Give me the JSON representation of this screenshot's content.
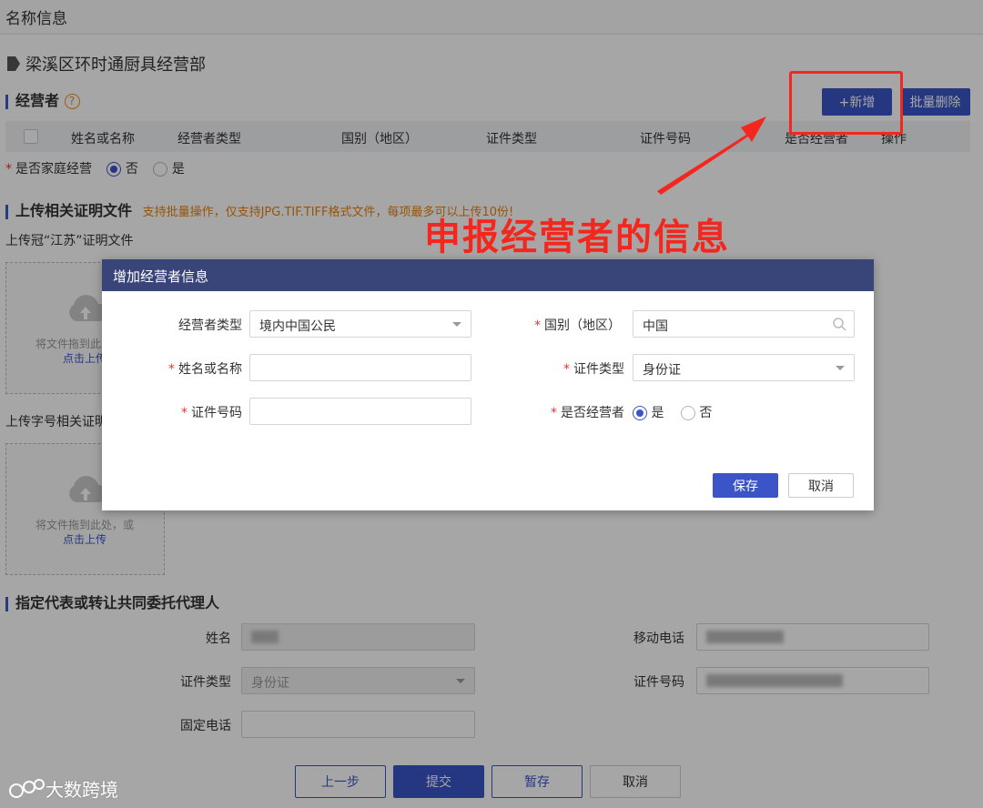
{
  "header": {
    "title": "名称信息"
  },
  "entity": {
    "name": "梁溪区环时通厨具经营部"
  },
  "operators": {
    "title": "经营者",
    "add_label": "+新增",
    "batch_delete_label": "批量删除",
    "columns": [
      "姓名或名称",
      "经营者类型",
      "国别（地区）",
      "证件类型",
      "证件号码",
      "是否经营者",
      "操作"
    ],
    "family_label": "是否家庭经营",
    "family_no": "否",
    "family_yes": "是"
  },
  "upload": {
    "title": "上传相关证明文件",
    "hint": "支持批量操作，仅支持JPG.TIF.TIFF格式文件，每项最多可以上传10份!",
    "guan_label": "上传冠“江苏”证明文件",
    "zihao_label": "上传字号相关证明",
    "drop_text": "将文件拖到此处，或",
    "drop_text_clipped": "将文件拖到此处",
    "click_upload": "点击上传",
    "click_upload_clipped": "点击上传"
  },
  "annotation": {
    "text": "申报经营者的信息",
    "color": "#f3271e"
  },
  "dialog": {
    "title": "增加经营者信息",
    "type_label": "经营者类型",
    "type_value": "境内中国公民",
    "country_label": "国别（地区）",
    "country_value": "中国",
    "name_label": "姓名或名称",
    "name_value": "",
    "idtype_label": "证件类型",
    "idtype_value": "身份证",
    "idno_label": "证件号码",
    "idno_value": "",
    "is_operator_label": "是否经营者",
    "yes": "是",
    "no": "否",
    "save": "保存",
    "cancel": "取消"
  },
  "agent": {
    "title": "指定代表或转让共同委托代理人",
    "name_label": "姓名",
    "mobile_label": "移动电话",
    "idtype_label": "证件类型",
    "idtype_value": "身份证",
    "idno_label": "证件号码",
    "phone_label": "固定电话"
  },
  "footer": {
    "prev": "上一步",
    "submit": "提交",
    "draft": "暂存",
    "cancel": "取消"
  },
  "watermark": {
    "text": "大数跨境"
  },
  "colors": {
    "primary": "#3b55c8",
    "dialog_header": "#394478",
    "required": "#e33333"
  }
}
